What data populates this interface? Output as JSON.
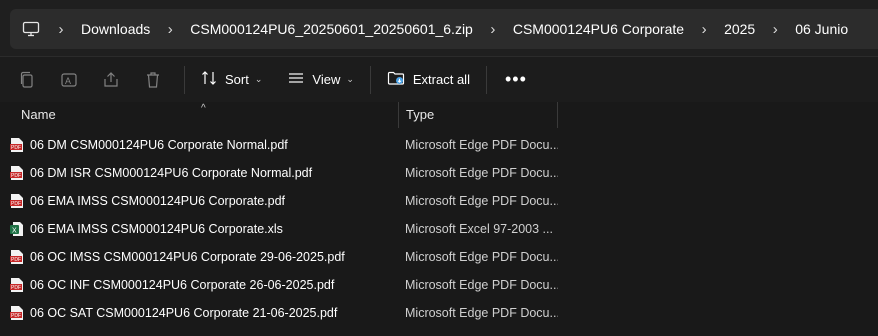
{
  "breadcrumbs": [
    "Downloads",
    "CSM000124PU6_20250601_20250601_6.zip",
    "CSM000124PU6 Corporate",
    "2025",
    "06 Junio"
  ],
  "toolbar": {
    "sort_label": "Sort",
    "view_label": "View",
    "extract_label": "Extract all",
    "more_label": "•••"
  },
  "columns": {
    "name": "Name",
    "type": "Type"
  },
  "files": [
    {
      "name": "06 DM CSM000124PU6 Corporate Normal.pdf",
      "type": "Microsoft Edge PDF Docu...",
      "icon": "pdf-file-icon"
    },
    {
      "name": "06 DM ISR CSM000124PU6 Corporate Normal.pdf",
      "type": "Microsoft Edge PDF Docu...",
      "icon": "pdf-file-icon"
    },
    {
      "name": "06 EMA IMSS CSM000124PU6 Corporate.pdf",
      "type": "Microsoft Edge PDF Docu...",
      "icon": "pdf-file-icon"
    },
    {
      "name": "06 EMA IMSS CSM000124PU6 Corporate.xls",
      "type": "Microsoft Excel 97-2003 ...",
      "icon": "excel-file-icon"
    },
    {
      "name": "06 OC IMSS CSM000124PU6 Corporate 29-06-2025.pdf",
      "type": "Microsoft Edge PDF Docu...",
      "icon": "pdf-file-icon"
    },
    {
      "name": "06 OC INF CSM000124PU6 Corporate 26-06-2025.pdf",
      "type": "Microsoft Edge PDF Docu...",
      "icon": "pdf-file-icon"
    },
    {
      "name": "06 OC SAT CSM000124PU6 Corporate 21-06-2025.pdf",
      "type": "Microsoft Edge PDF Docu...",
      "icon": "pdf-file-icon"
    }
  ],
  "colors": {
    "pdf_icon": "#c62828",
    "excel_icon": "#1e7145",
    "background": "#191919"
  }
}
